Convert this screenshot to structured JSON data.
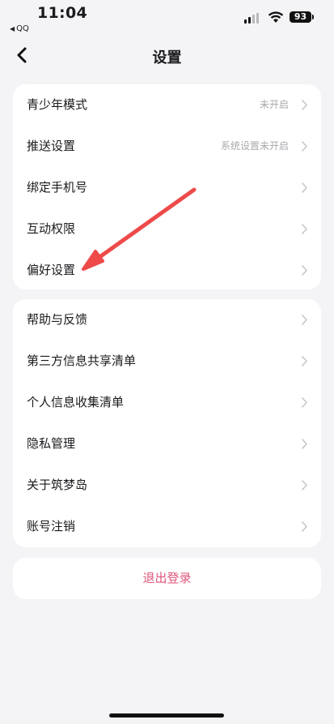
{
  "status_bar": {
    "time": "11:04",
    "back_app": "QQ",
    "battery": "93"
  },
  "nav": {
    "title": "设置"
  },
  "section1": [
    {
      "label": "青少年模式",
      "value": "未开启"
    },
    {
      "label": "推送设置",
      "value": "系统设置未开启"
    },
    {
      "label": "绑定手机号",
      "value": ""
    },
    {
      "label": "互动权限",
      "value": ""
    },
    {
      "label": "偏好设置",
      "value": ""
    }
  ],
  "section2": [
    {
      "label": "帮助与反馈"
    },
    {
      "label": "第三方信息共享清单"
    },
    {
      "label": "个人信息收集清单"
    },
    {
      "label": "隐私管理"
    },
    {
      "label": "关于筑梦岛"
    },
    {
      "label": "账号注销"
    }
  ],
  "logout_label": "退出登录",
  "colors": {
    "background": "#f4f4f6",
    "accent": "#e0577a",
    "annotation_arrow": "#ee4a4a",
    "secondary_text": "#a9a9ae"
  }
}
